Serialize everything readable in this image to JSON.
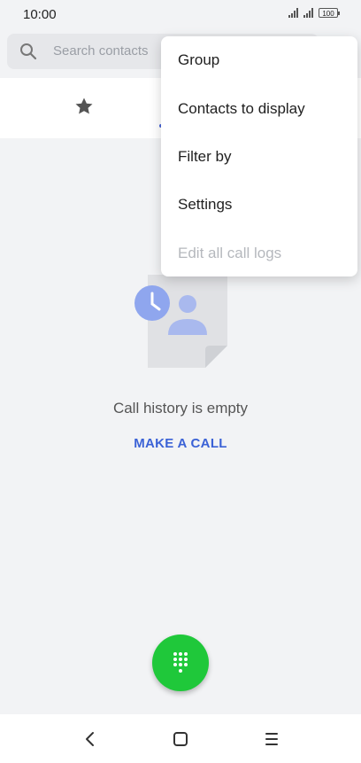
{
  "status_bar": {
    "time": "10:00",
    "battery": "100"
  },
  "search": {
    "placeholder": "Search contacts"
  },
  "tabs": {
    "favorites_icon": "star-icon"
  },
  "empty_state": {
    "message": "Call history is empty",
    "action_label": "MAKE A CALL",
    "illustration": "contact-card-with-clock"
  },
  "fab": {
    "icon": "dialpad-icon",
    "color": "#1fc83a"
  },
  "overflow_menu": {
    "items": [
      {
        "label": "Group",
        "enabled": true
      },
      {
        "label": "Contacts to display",
        "enabled": true
      },
      {
        "label": "Filter by",
        "enabled": true
      },
      {
        "label": "Settings",
        "enabled": true
      },
      {
        "label": "Edit all call logs",
        "enabled": false
      }
    ]
  },
  "nav_bar": {
    "back_icon": "back-icon",
    "home_icon": "home-icon",
    "menu_icon": "menu-icon"
  },
  "colors": {
    "accent": "#3b62d6",
    "background": "#f2f3f5"
  }
}
